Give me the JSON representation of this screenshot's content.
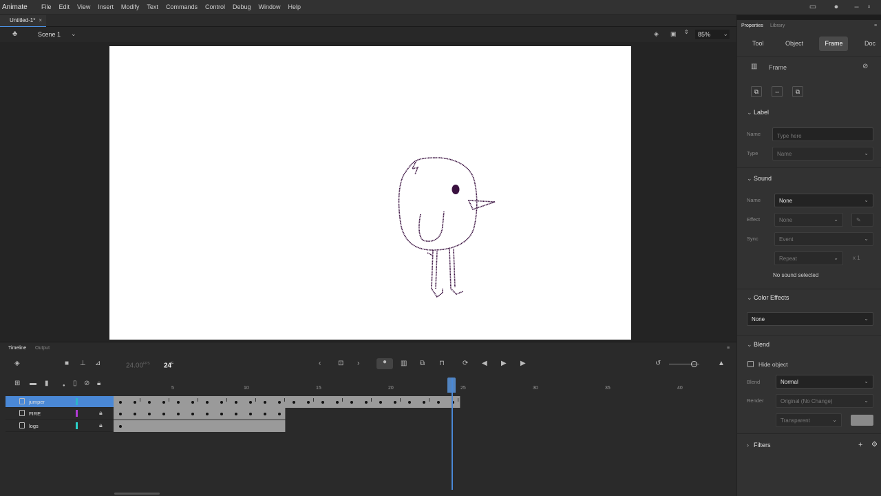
{
  "app": {
    "name": "Animate"
  },
  "menus": [
    "File",
    "Edit",
    "View",
    "Insert",
    "Modify",
    "Text",
    "Commands",
    "Control",
    "Debug",
    "Window",
    "Help"
  ],
  "document": {
    "tab_title": "Untitled-1*",
    "scene": "Scene 1",
    "zoom": "85%"
  },
  "properties_panel": {
    "tabs": [
      "Properties",
      "Library"
    ],
    "segments": [
      "Tool",
      "Object",
      "Frame",
      "Doc"
    ],
    "active_segment": "Frame",
    "header": "Frame",
    "label_section": {
      "title": "Label",
      "name_label": "Name",
      "name_placeholder": "Type here",
      "type_label": "Type",
      "type_value": "Name"
    },
    "sound_section": {
      "title": "Sound",
      "name_label": "Name",
      "name_value": "None",
      "effect_label": "Effect",
      "effect_value": "None",
      "sync_label": "Sync",
      "sync_value": "Event",
      "repeat_value": "Repeat",
      "repeat_count": "x 1",
      "status": "No sound selected"
    },
    "color_effects": {
      "title": "Color Effects",
      "value": "None"
    },
    "blend_section": {
      "title": "Blend",
      "hide_object": "Hide object",
      "blend_label": "Blend",
      "blend_value": "Normal",
      "render_label": "Render",
      "render_value": "Original (No Change)",
      "transparent_value": "Transparent"
    },
    "filters": {
      "title": "Filters"
    }
  },
  "timeline": {
    "tabs": [
      "Timeline",
      "Output"
    ],
    "fps": "24.00",
    "fps_unit": "FPS",
    "current_frame": "24",
    "frame_unit": "F",
    "ruler_numbers": [
      "5",
      "10",
      "15",
      "20",
      "25",
      "30",
      "35",
      "40"
    ],
    "layers": [
      {
        "name": "jumper",
        "color": "#2bb5c9",
        "locked": false,
        "selected": true,
        "frames": 24
      },
      {
        "name": "FIRE",
        "color": "#b03bd4",
        "locked": true,
        "selected": false,
        "frames": 12
      },
      {
        "name": "logs",
        "color": "#2bd0c8",
        "locked": true,
        "selected": false,
        "frames": 12
      }
    ]
  },
  "colors": {
    "accent": "#4a88d6",
    "stage": "#ffffff",
    "panel": "#323232"
  }
}
